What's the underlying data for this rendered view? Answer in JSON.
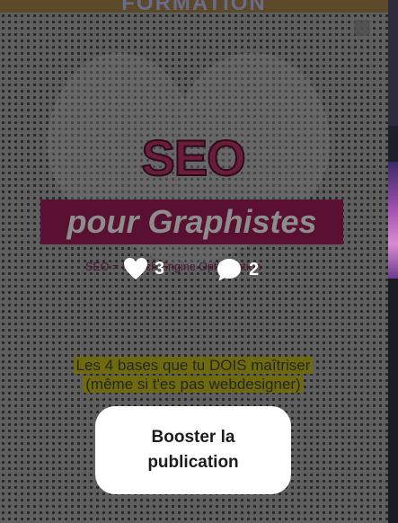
{
  "post": {
    "top_banner_text": "FORMATION",
    "seo_title": "SEO",
    "subtitle": "pour Graphistes",
    "seo_definition": "SEO = Search Engine Optimization",
    "bases_text": "Les 4 bases que tu DOIS maîtriser (même si t'es pas webdesigner)"
  },
  "stats": {
    "likes": "3",
    "comments": "2"
  },
  "boost_button": {
    "label": "Booster la publication"
  },
  "icons": {
    "likes": "heart-icon",
    "comments": "comment-bubble-icon"
  },
  "colors": {
    "overlay": "#5f5f5f",
    "seo_band": "#5a1030",
    "highlight": "#6f6a0e",
    "button_bg": "#ffffff"
  }
}
